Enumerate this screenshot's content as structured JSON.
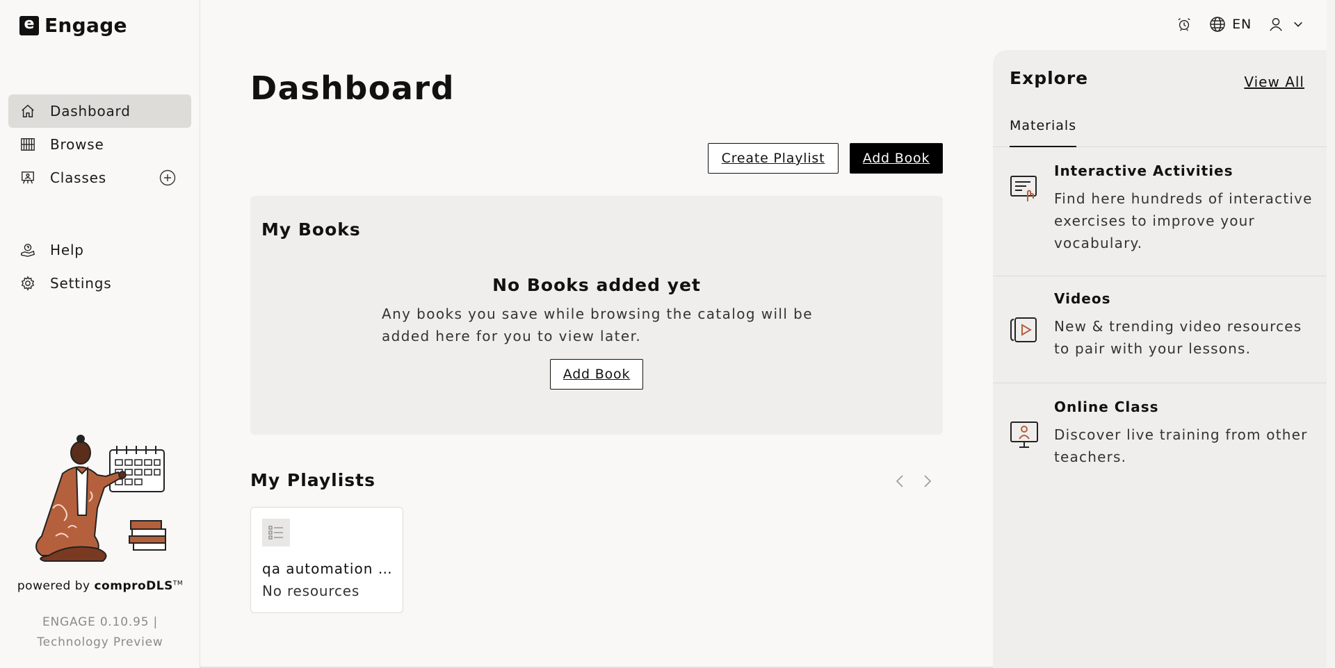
{
  "app": {
    "name": "Engage",
    "logo_letter": "e"
  },
  "sidebar": {
    "items": [
      {
        "label": "Dashboard",
        "icon": "home-icon",
        "active": true
      },
      {
        "label": "Browse",
        "icon": "bookshelf-icon"
      },
      {
        "label": "Classes",
        "icon": "classroom-icon",
        "action_icon": "add-circle-icon"
      },
      {
        "label": "Help",
        "icon": "help-support-icon"
      },
      {
        "label": "Settings",
        "icon": "gear-icon"
      }
    ],
    "powered_prefix": "powered by",
    "powered_brand": "comproDLS",
    "powered_tm": "TM",
    "version_line1": "ENGAGE 0.10.95 |",
    "version_line2": "Technology Preview"
  },
  "header": {
    "language": "EN",
    "icons": [
      "alarm-icon",
      "globe-icon",
      "user-icon",
      "chevron-down-icon"
    ]
  },
  "main": {
    "title": "Dashboard",
    "create_playlist_label": "Create Playlist",
    "add_book_label": "Add Book",
    "my_books": {
      "title": "My Books",
      "empty_title": "No Books added yet",
      "empty_text": "Any books you save while browsing the catalog will be added here for you to view later.",
      "add_book_label": "Add Book"
    },
    "my_playlists": {
      "title": "My Playlists",
      "items": [
        {
          "name": "qa automation playlist",
          "subtitle": "No resources"
        }
      ]
    }
  },
  "explore": {
    "title": "Explore",
    "view_all_label": "View All",
    "tabs": [
      {
        "label": "Materials",
        "active": true
      }
    ],
    "items": [
      {
        "name": "Interactive Activities",
        "description": "Find here hundreds of interactive exercises to improve your vocabulary.",
        "icon": "interactive-activity-icon"
      },
      {
        "name": "Videos",
        "description": "New & trending video resources to pair with your lessons.",
        "icon": "video-icon"
      },
      {
        "name": "Online Class",
        "description": "Discover live training from other teachers.",
        "icon": "online-class-icon"
      }
    ]
  },
  "colors": {
    "accent": "#000000",
    "background": "#f9f8f6",
    "panel": "#efeeec",
    "illustration_brown": "#b5603d"
  }
}
